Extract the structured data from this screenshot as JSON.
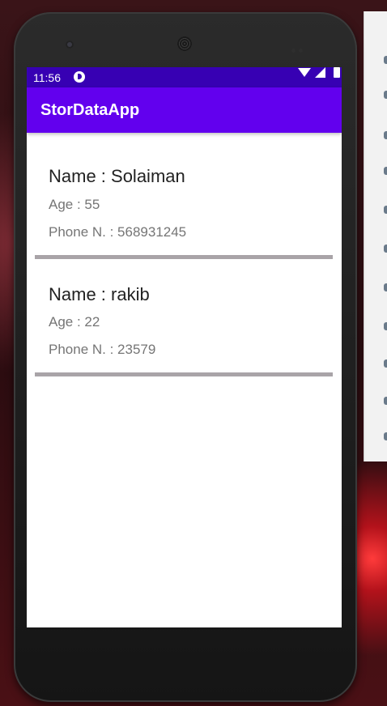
{
  "status_bar": {
    "time": "11:56"
  },
  "app_bar": {
    "title": "StorDataApp"
  },
  "contacts": [
    {
      "name_line": "Name : Solaiman",
      "age_line": "Age : 55",
      "phone_line": "Phone N. : 568931245"
    },
    {
      "name_line": "Name : rakib",
      "age_line": "Age : 22",
      "phone_line": "Phone N. : 23579"
    }
  ],
  "colors": {
    "status_bar": "#3700b3",
    "app_bar": "#6200ee",
    "divider": "#a9a4a8"
  },
  "icons": [
    "app-status-icon",
    "wifi-icon",
    "signal-icon",
    "battery-icon"
  ]
}
